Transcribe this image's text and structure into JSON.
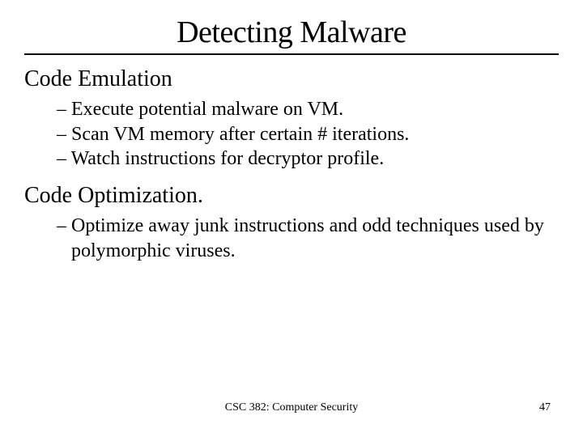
{
  "title": "Detecting Malware",
  "sections": [
    {
      "heading": "Code Emulation",
      "bullets": [
        "Execute potential malware on VM.",
        "Scan VM memory after certain # iterations.",
        "Watch instructions for decryptor profile."
      ]
    },
    {
      "heading": "Code Optimization.",
      "bullets": [
        "Optimize away junk instructions and odd techniques used by polymorphic viruses."
      ]
    }
  ],
  "footer": {
    "course": "CSC 382: Computer Security",
    "page": "47"
  }
}
